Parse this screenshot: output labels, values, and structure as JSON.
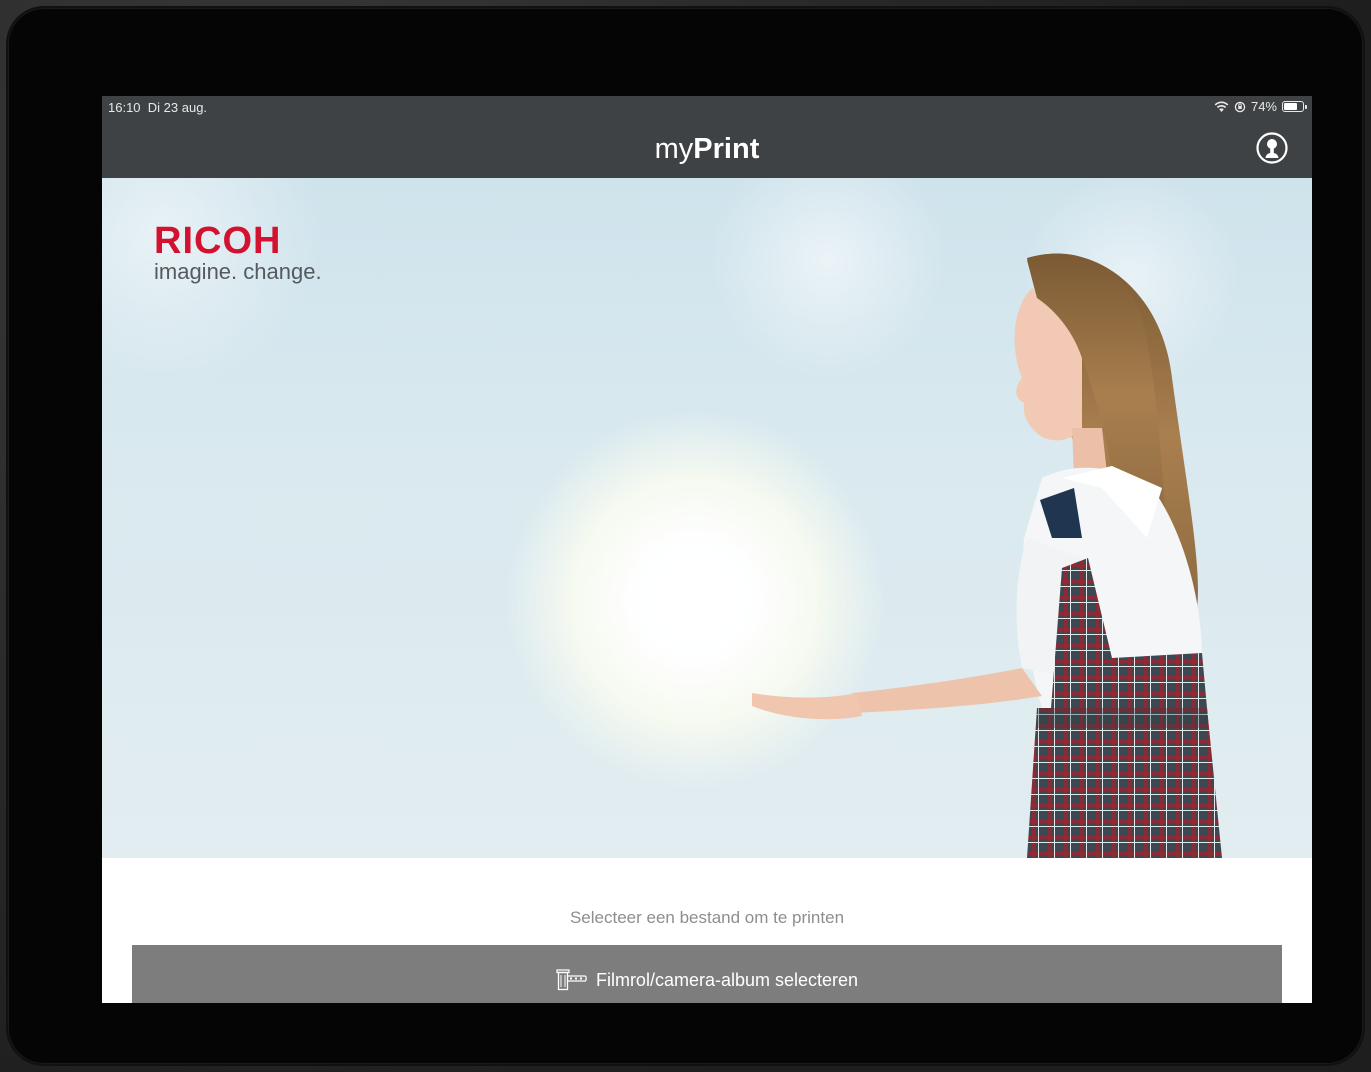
{
  "status_bar": {
    "time": "16:10",
    "date": "Di 23 aug.",
    "battery_percent": "74%",
    "battery_level": 0.74
  },
  "nav": {
    "title_prefix": "my",
    "title_bold": "Print"
  },
  "hero": {
    "brand_name": "RICOH",
    "brand_tagline": "imagine. change."
  },
  "main": {
    "prompt": "Selecteer een bestand om te printen",
    "album_button_label": "Filmrol/camera-album selecteren",
    "album_button_icon": "camera-roll-icon"
  },
  "colors": {
    "nav_background": "#3f4244",
    "brand_red": "#d2122e",
    "button_gray": "#7d7d7d"
  }
}
